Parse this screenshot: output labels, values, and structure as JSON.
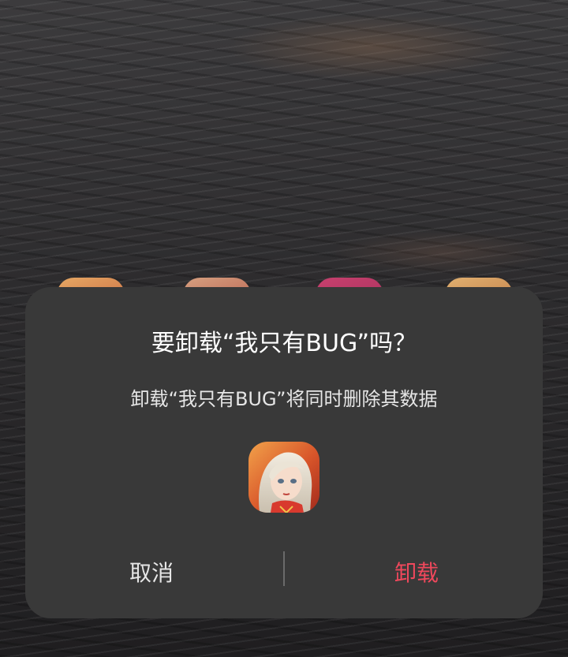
{
  "dialog": {
    "title": "要卸载“我只有BUG”吗？",
    "message": "卸载“我只有BUG”将同时删除其数据",
    "app_icon": "game-character-icon",
    "cancel_label": "取消",
    "confirm_label": "卸载"
  },
  "colors": {
    "dialog_background": "#393939",
    "confirm_text": "#f0485c",
    "cancel_text": "#e6e6e6"
  }
}
